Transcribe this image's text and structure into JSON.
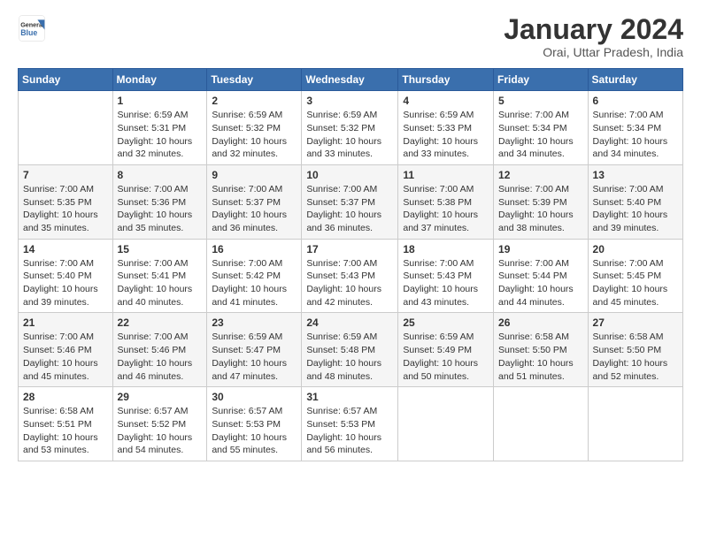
{
  "header": {
    "logo_line1": "General",
    "logo_line2": "Blue",
    "title": "January 2024",
    "location": "Orai, Uttar Pradesh, India"
  },
  "columns": [
    "Sunday",
    "Monday",
    "Tuesday",
    "Wednesday",
    "Thursday",
    "Friday",
    "Saturday"
  ],
  "weeks": [
    [
      {
        "day": "",
        "info": ""
      },
      {
        "day": "1",
        "info": "Sunrise: 6:59 AM\nSunset: 5:31 PM\nDaylight: 10 hours\nand 32 minutes."
      },
      {
        "day": "2",
        "info": "Sunrise: 6:59 AM\nSunset: 5:32 PM\nDaylight: 10 hours\nand 32 minutes."
      },
      {
        "day": "3",
        "info": "Sunrise: 6:59 AM\nSunset: 5:32 PM\nDaylight: 10 hours\nand 33 minutes."
      },
      {
        "day": "4",
        "info": "Sunrise: 6:59 AM\nSunset: 5:33 PM\nDaylight: 10 hours\nand 33 minutes."
      },
      {
        "day": "5",
        "info": "Sunrise: 7:00 AM\nSunset: 5:34 PM\nDaylight: 10 hours\nand 34 minutes."
      },
      {
        "day": "6",
        "info": "Sunrise: 7:00 AM\nSunset: 5:34 PM\nDaylight: 10 hours\nand 34 minutes."
      }
    ],
    [
      {
        "day": "7",
        "info": "Sunrise: 7:00 AM\nSunset: 5:35 PM\nDaylight: 10 hours\nand 35 minutes."
      },
      {
        "day": "8",
        "info": "Sunrise: 7:00 AM\nSunset: 5:36 PM\nDaylight: 10 hours\nand 35 minutes."
      },
      {
        "day": "9",
        "info": "Sunrise: 7:00 AM\nSunset: 5:37 PM\nDaylight: 10 hours\nand 36 minutes."
      },
      {
        "day": "10",
        "info": "Sunrise: 7:00 AM\nSunset: 5:37 PM\nDaylight: 10 hours\nand 36 minutes."
      },
      {
        "day": "11",
        "info": "Sunrise: 7:00 AM\nSunset: 5:38 PM\nDaylight: 10 hours\nand 37 minutes."
      },
      {
        "day": "12",
        "info": "Sunrise: 7:00 AM\nSunset: 5:39 PM\nDaylight: 10 hours\nand 38 minutes."
      },
      {
        "day": "13",
        "info": "Sunrise: 7:00 AM\nSunset: 5:40 PM\nDaylight: 10 hours\nand 39 minutes."
      }
    ],
    [
      {
        "day": "14",
        "info": "Sunrise: 7:00 AM\nSunset: 5:40 PM\nDaylight: 10 hours\nand 39 minutes."
      },
      {
        "day": "15",
        "info": "Sunrise: 7:00 AM\nSunset: 5:41 PM\nDaylight: 10 hours\nand 40 minutes."
      },
      {
        "day": "16",
        "info": "Sunrise: 7:00 AM\nSunset: 5:42 PM\nDaylight: 10 hours\nand 41 minutes."
      },
      {
        "day": "17",
        "info": "Sunrise: 7:00 AM\nSunset: 5:43 PM\nDaylight: 10 hours\nand 42 minutes."
      },
      {
        "day": "18",
        "info": "Sunrise: 7:00 AM\nSunset: 5:43 PM\nDaylight: 10 hours\nand 43 minutes."
      },
      {
        "day": "19",
        "info": "Sunrise: 7:00 AM\nSunset: 5:44 PM\nDaylight: 10 hours\nand 44 minutes."
      },
      {
        "day": "20",
        "info": "Sunrise: 7:00 AM\nSunset: 5:45 PM\nDaylight: 10 hours\nand 45 minutes."
      }
    ],
    [
      {
        "day": "21",
        "info": "Sunrise: 7:00 AM\nSunset: 5:46 PM\nDaylight: 10 hours\nand 45 minutes."
      },
      {
        "day": "22",
        "info": "Sunrise: 7:00 AM\nSunset: 5:46 PM\nDaylight: 10 hours\nand 46 minutes."
      },
      {
        "day": "23",
        "info": "Sunrise: 6:59 AM\nSunset: 5:47 PM\nDaylight: 10 hours\nand 47 minutes."
      },
      {
        "day": "24",
        "info": "Sunrise: 6:59 AM\nSunset: 5:48 PM\nDaylight: 10 hours\nand 48 minutes."
      },
      {
        "day": "25",
        "info": "Sunrise: 6:59 AM\nSunset: 5:49 PM\nDaylight: 10 hours\nand 50 minutes."
      },
      {
        "day": "26",
        "info": "Sunrise: 6:58 AM\nSunset: 5:50 PM\nDaylight: 10 hours\nand 51 minutes."
      },
      {
        "day": "27",
        "info": "Sunrise: 6:58 AM\nSunset: 5:50 PM\nDaylight: 10 hours\nand 52 minutes."
      }
    ],
    [
      {
        "day": "28",
        "info": "Sunrise: 6:58 AM\nSunset: 5:51 PM\nDaylight: 10 hours\nand 53 minutes."
      },
      {
        "day": "29",
        "info": "Sunrise: 6:57 AM\nSunset: 5:52 PM\nDaylight: 10 hours\nand 54 minutes."
      },
      {
        "day": "30",
        "info": "Sunrise: 6:57 AM\nSunset: 5:53 PM\nDaylight: 10 hours\nand 55 minutes."
      },
      {
        "day": "31",
        "info": "Sunrise: 6:57 AM\nSunset: 5:53 PM\nDaylight: 10 hours\nand 56 minutes."
      },
      {
        "day": "",
        "info": ""
      },
      {
        "day": "",
        "info": ""
      },
      {
        "day": "",
        "info": ""
      }
    ]
  ]
}
